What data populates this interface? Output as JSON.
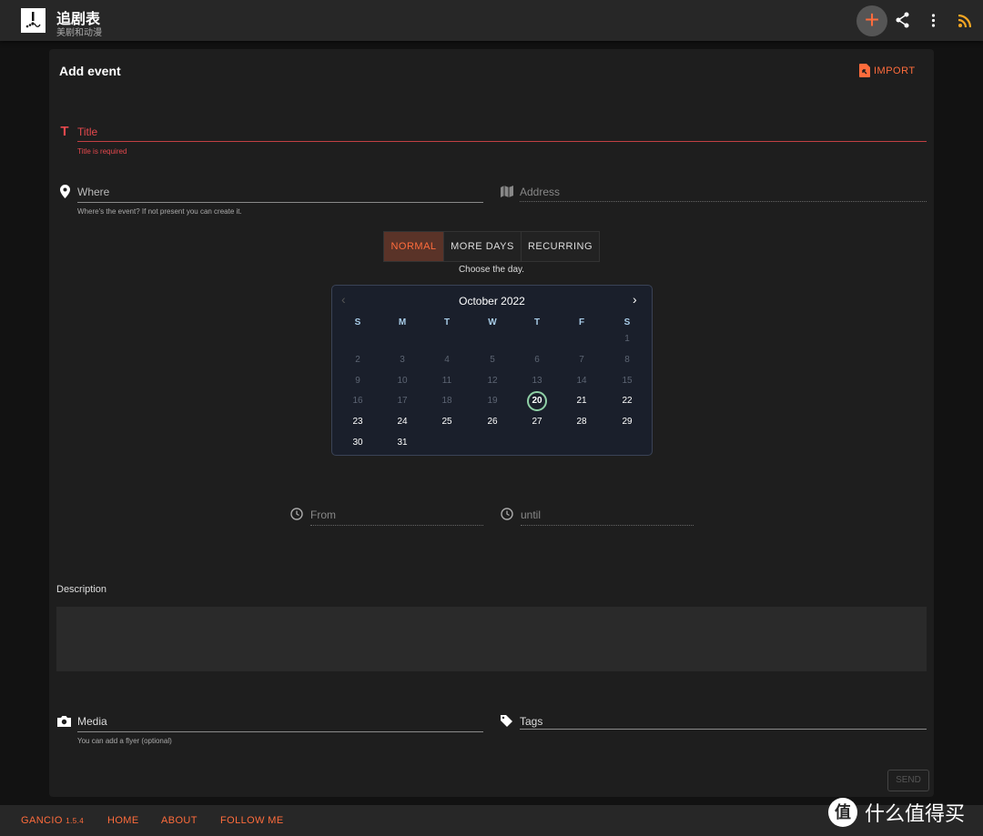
{
  "header": {
    "title": "追剧表",
    "subtitle": "美剧和动漫",
    "icons": [
      "add-icon",
      "share-icon",
      "more-vert-icon",
      "rss-icon"
    ]
  },
  "card": {
    "title": "Add event",
    "import_label": "IMPORT"
  },
  "form": {
    "title_label": "Title",
    "title_error": "Title is required",
    "where_label": "Where",
    "where_hint": "Where's the event? If not present you can create it.",
    "address_label": "Address",
    "modes": [
      "NORMAL",
      "MORE DAYS",
      "RECURRING"
    ],
    "active_mode": "NORMAL",
    "choose_hint": "Choose the day.",
    "from_label": "From",
    "until_label": "until",
    "description_label": "Description",
    "media_label": "Media",
    "media_hint": "You can add a flyer (optional)",
    "tags_label": "Tags",
    "send_label": "SEND"
  },
  "calendar": {
    "month_label": "October 2022",
    "weekdays": [
      "S",
      "M",
      "T",
      "W",
      "T",
      "F",
      "S"
    ],
    "days_in_month": 31,
    "first_weekday": 6,
    "selected_day": 20,
    "first_enabled_day": 20
  },
  "footer": {
    "brand": "GANCIO",
    "version": "1.5.4",
    "links": [
      "HOME",
      "ABOUT",
      "FOLLOW ME"
    ],
    "watermark": "什么值得买"
  },
  "colors": {
    "accent": "#ff6c3c",
    "error": "#e5484d",
    "selected_ring": "#8fd0a6"
  }
}
